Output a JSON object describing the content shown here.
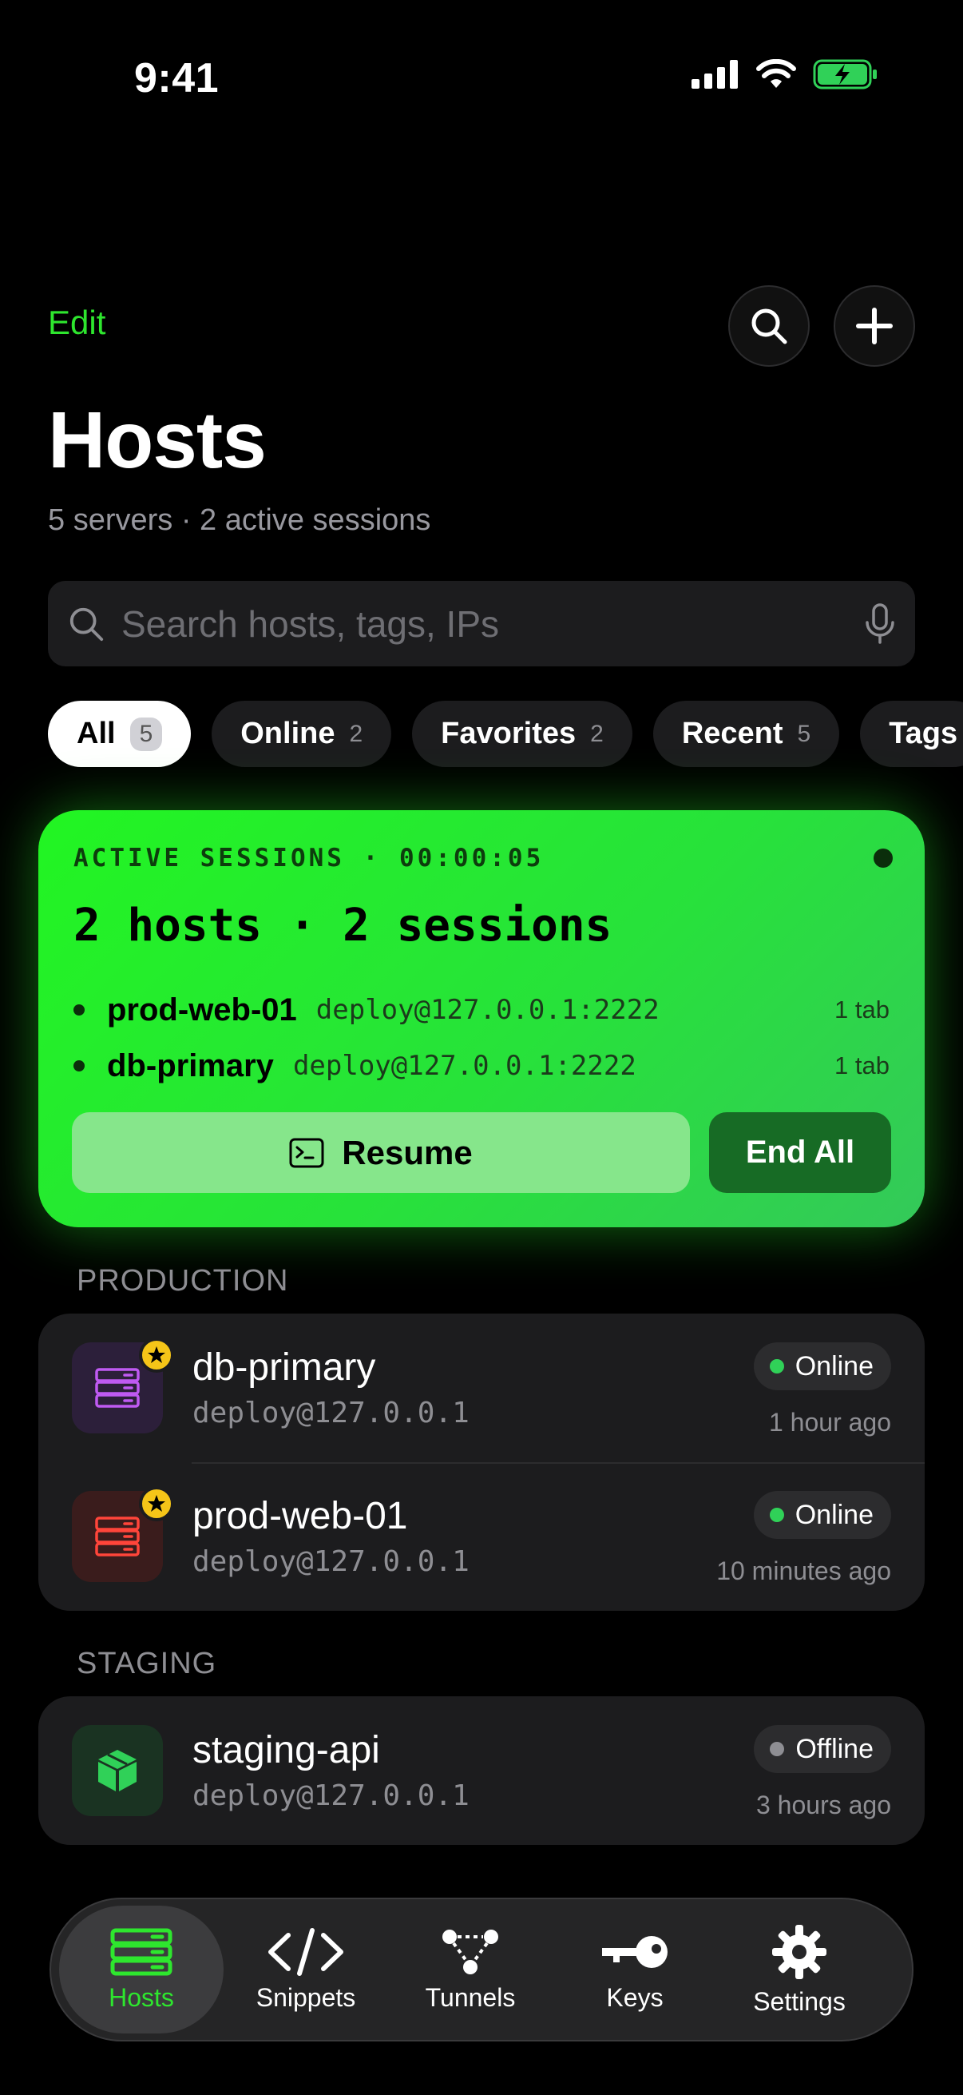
{
  "status_bar": {
    "time": "9:41"
  },
  "header": {
    "edit_label": "Edit",
    "title": "Hosts",
    "subtitle": "5 servers · 2 active sessions"
  },
  "search": {
    "placeholder": "Search hosts, tags, IPs"
  },
  "filters": [
    {
      "label": "All",
      "count": "5",
      "active": true
    },
    {
      "label": "Online",
      "count": "2"
    },
    {
      "label": "Favorites",
      "count": "2"
    },
    {
      "label": "Recent",
      "count": "5"
    },
    {
      "label": "Tags",
      "count": ""
    }
  ],
  "active_sessions": {
    "label": "ACTIVE SESSIONS · 00:00:05",
    "headline": "2 hosts · 2 sessions",
    "sessions": [
      {
        "host": "prod-web-01",
        "address": "deploy@127.0.0.1:2222",
        "tabs": "1 tab"
      },
      {
        "host": "db-primary",
        "address": "deploy@127.0.0.1:2222",
        "tabs": "1 tab"
      }
    ],
    "resume_label": "Resume",
    "end_all_label": "End All"
  },
  "sections": [
    {
      "title": "PRODUCTION",
      "hosts": [
        {
          "name": "db-primary",
          "address": "deploy@127.0.0.1",
          "status": "Online",
          "last_seen": "1 hour ago",
          "favorite": true,
          "icon": "server-icon",
          "color": "#bf5af2"
        },
        {
          "name": "prod-web-01",
          "address": "deploy@127.0.0.1",
          "status": "Online",
          "last_seen": "10 minutes ago",
          "favorite": true,
          "icon": "server-icon",
          "color": "#ff453a"
        }
      ]
    },
    {
      "title": "STAGING",
      "hosts": [
        {
          "name": "staging-api",
          "address": "deploy@127.0.0.1",
          "status": "Offline",
          "last_seen": "3 hours ago",
          "favorite": false,
          "icon": "cube-icon",
          "color": "#30d158"
        }
      ]
    }
  ],
  "tabbar": [
    {
      "label": "Hosts",
      "icon": "server-icon",
      "selected": true
    },
    {
      "label": "Snippets",
      "icon": "code-icon"
    },
    {
      "label": "Tunnels",
      "icon": "tunnel-icon"
    },
    {
      "label": "Keys",
      "icon": "key-icon"
    },
    {
      "label": "Settings",
      "icon": "gear-icon"
    }
  ],
  "colors": {
    "accent": "#2ee62e",
    "online": "#30d158",
    "offline": "#8e8e93",
    "star": "#f5c518"
  }
}
